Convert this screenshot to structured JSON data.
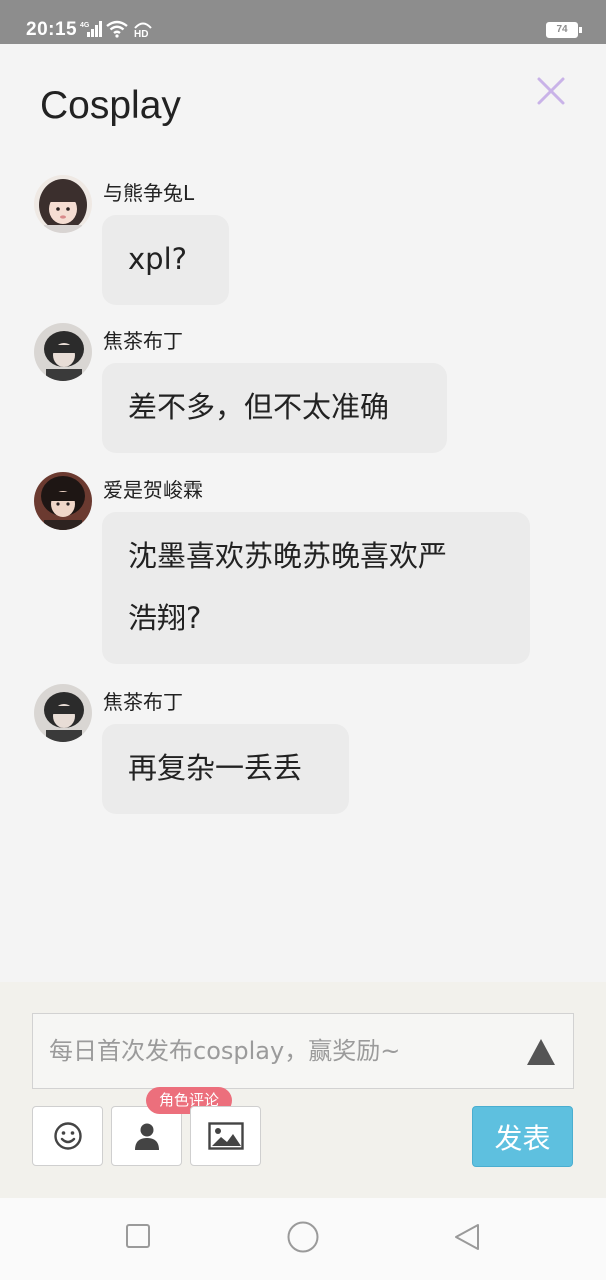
{
  "status_bar": {
    "time": "20:15",
    "network": "4G",
    "hd": "HD",
    "battery": "74"
  },
  "header": {
    "title": "Cosplay"
  },
  "messages": [
    {
      "username": "与熊争兔L",
      "lines": [
        "xpl?"
      ],
      "avatar": "avatar-girl-icon"
    },
    {
      "username": "焦茶布丁",
      "lines": [
        "差不多，但不太准确"
      ],
      "avatar": "avatar-boy-icon"
    },
    {
      "username": "爱是贺峻霖",
      "lines": [
        "沈墨喜欢苏晚苏晚喜欢严",
        "浩翔?"
      ],
      "avatar": "avatar-girl-dark-icon"
    },
    {
      "username": "焦茶布丁",
      "lines": [
        "再复杂一丢丢"
      ],
      "avatar": "avatar-boy-icon"
    }
  ],
  "composer": {
    "placeholder": "每日首次发布cosplay，赢奖励~",
    "role_badge": "角色评论",
    "publish_label": "发表"
  },
  "colors": {
    "accent": "#5ec0df",
    "badge": "#ec6f7c",
    "close": "#c9b3e8"
  }
}
